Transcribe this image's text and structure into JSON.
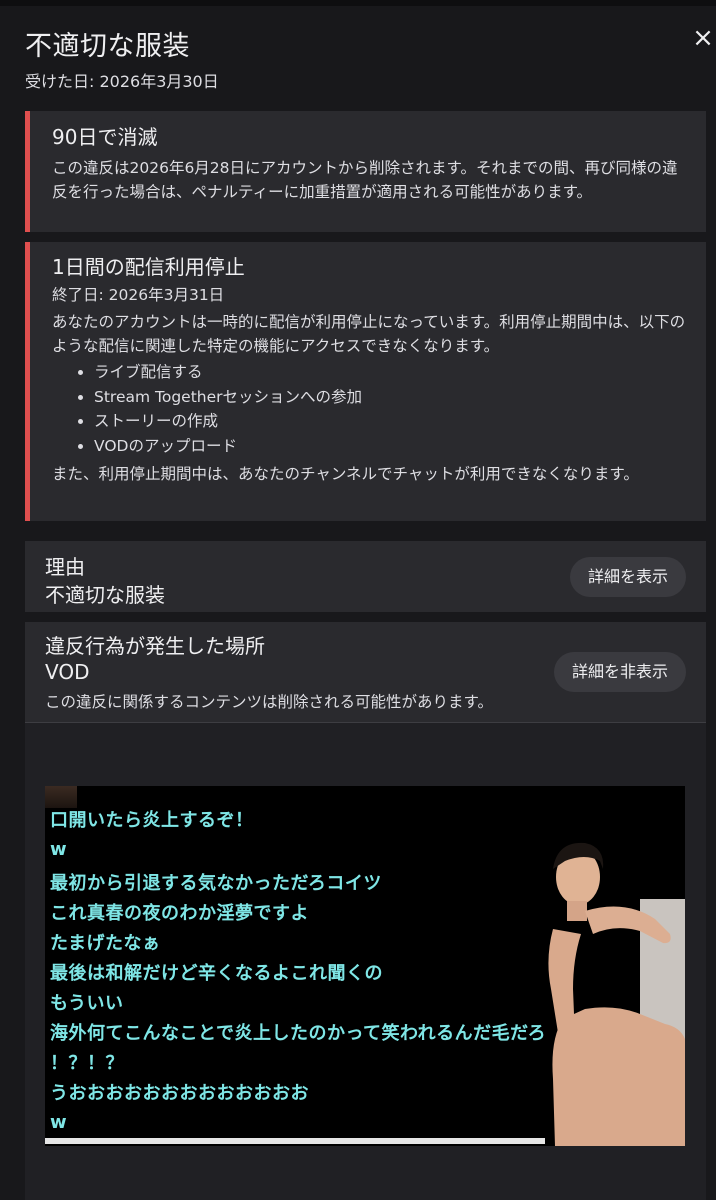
{
  "dialog": {
    "title": "不適切な服装",
    "received": "受けた日: 2026年3月30日",
    "close_symbol": "×"
  },
  "expire_card": {
    "title": "90日で消滅",
    "body": "この違反は2026年6月28日にアカウントから削除されます。それまでの間、再び同様の違反を行った場合は、ペナルティーに加重措置が適用される可能性があります。"
  },
  "suspend_card": {
    "title": "1日間の配信利用停止",
    "end_date": "終了日: 2026年3月31日",
    "body": "あなたのアカウントは一時的に配信が利用停止になっています。利用停止期間中は、以下のような配信に関連した特定の機能にアクセスできなくなります。",
    "items": [
      "ライブ配信する",
      "Stream Togetherセッションへの参加",
      "ストーリーの作成",
      "VODのアップロード"
    ],
    "footer": "また、利用停止期間中は、あなたのチャンネルでチャットが利用できなくなります。"
  },
  "reason": {
    "label": "理由",
    "value": "不適切な服装",
    "button": "詳細を表示"
  },
  "location": {
    "label": "違反行為が発生した場所",
    "value": "VOD",
    "button": "詳細を非表示",
    "note": "この違反に関係するコンテンツは削除される可能性があります。"
  },
  "vod_chat": [
    "口開いたら炎上するぞ！",
    "w",
    "最初から引退する気なかっただろコイツ",
    "これ真春の夜のわか淫夢ですよ",
    "たまげたなぁ",
    "最後は和解だけど辛くなるよこれ聞くの",
    "もういい",
    "海外何てこんなことで炎上したのかって笑われるんだ毛だろ",
    "！？！？",
    "うおおおおおおおおおおおおお",
    "w"
  ],
  "colors": {
    "background": "#18181b",
    "card": "#2a2a2e",
    "accent_red": "#e04f4f",
    "chat_text": "#7fe6e6"
  }
}
